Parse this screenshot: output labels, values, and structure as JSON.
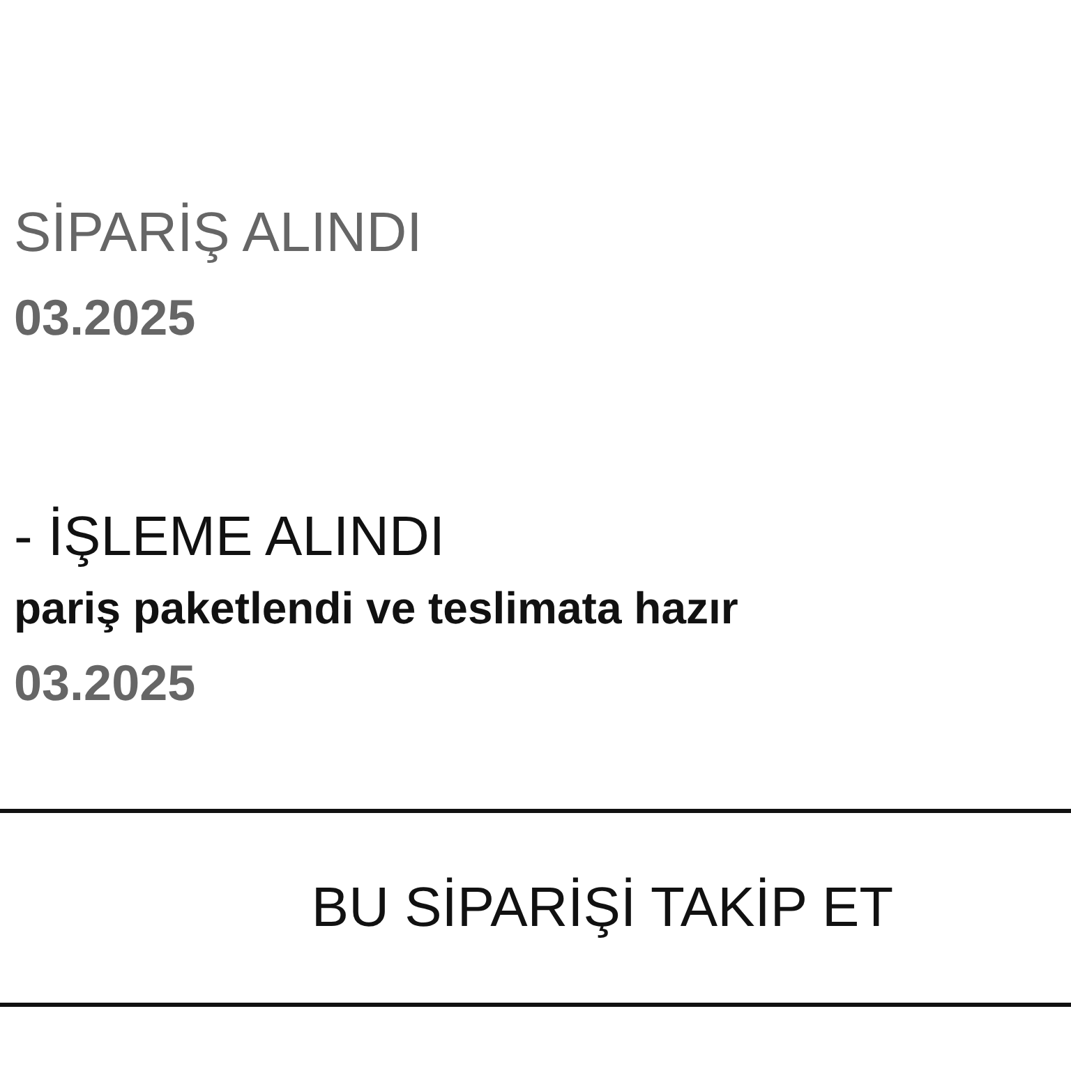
{
  "timeline": [
    {
      "status": "SİPARİŞ ALINDI",
      "current": false,
      "date": "03.2025"
    },
    {
      "status": "- İŞLEME ALINDI",
      "current": true,
      "description": "pariş paketlendi ve teslimata hazır",
      "date": "03.2025"
    }
  ],
  "track_button": {
    "label": "BU SİPARİŞİ TAKİP ET"
  }
}
